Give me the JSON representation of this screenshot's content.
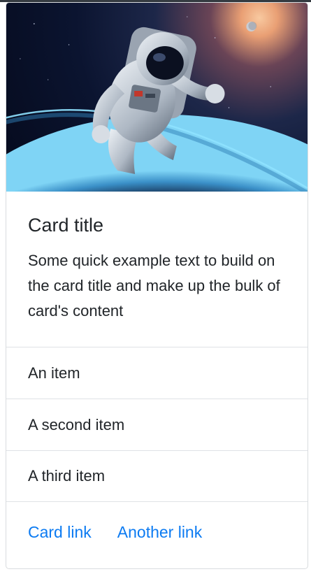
{
  "card": {
    "image_alt": "Astronaut floating in space above Earth",
    "title": "Card title",
    "text": "Some quick example text to build on the card title and make up the bulk of card's content",
    "items": [
      {
        "label": "An item"
      },
      {
        "label": "A second item"
      },
      {
        "label": "A third item"
      }
    ],
    "links": [
      {
        "label": "Card link"
      },
      {
        "label": "Another link"
      }
    ]
  },
  "colors": {
    "link": "#0c7bf2",
    "text": "#212529",
    "border": "#dfe2e6"
  }
}
